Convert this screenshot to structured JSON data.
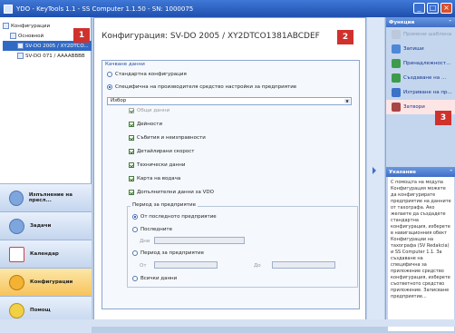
{
  "window": {
    "title": "YDO - KeyTools 1.1 - SS Computer 1.1.50 - SN: 1000075"
  },
  "tree": {
    "items": [
      {
        "label": "Конфигурации"
      },
      {
        "label": "Основной"
      },
      {
        "label": "SV-DO 2005 / XY2DTCO...",
        "selected": true
      },
      {
        "label": "SV-DO 071 / AAAABBBB"
      }
    ]
  },
  "nav": {
    "items": [
      {
        "label": "Изпълнение на пресл...",
        "icon": "clock-icon"
      },
      {
        "label": "Задачи",
        "icon": "tasks-icon"
      },
      {
        "label": "Календар",
        "icon": "calendar-icon"
      },
      {
        "label": "Конфигурации",
        "icon": "gear-icon",
        "active": true
      },
      {
        "label": "Помощ",
        "icon": "help-icon"
      }
    ]
  },
  "main": {
    "title": "Конфигурация: SV-DO 2005 / XY2DTCO1381ABCDEF",
    "group_label": "Качване данни",
    "radio_standard": "Стандартна конфигурация",
    "radio_specific": "Специфична на производителя средство настройки за предприятие",
    "select_value": "Избор",
    "checkboxes": [
      {
        "label": "Общи данни",
        "checked": true,
        "disabled": true
      },
      {
        "label": "Дейности",
        "checked": true
      },
      {
        "label": "Събития и неизправности",
        "checked": true
      },
      {
        "label": "Детайлирани скорост",
        "checked": true
      },
      {
        "label": "Технически данни",
        "checked": true
      },
      {
        "label": "Карта на водача",
        "checked": true
      },
      {
        "label": "Допълнителни данни за VDO",
        "checked": true
      }
    ],
    "period_label": "Период за предприятие",
    "period_options": [
      {
        "label": "От последното предприятие",
        "checked": true
      },
      {
        "label": "Последните",
        "checked": false
      },
      {
        "label": "Период за предприятие",
        "checked": false
      },
      {
        "label": "Всички данни",
        "checked": false
      }
    ],
    "days_label": "Дни",
    "from_label": "От",
    "to_label": "До"
  },
  "badges": [
    "1",
    "2",
    "3"
  ],
  "right": {
    "actions_title": "Функции",
    "actions": [
      {
        "label": "Промени шаблона",
        "disabled": true
      },
      {
        "label": "Запиши",
        "disabled": false
      },
      {
        "label": "Принадлежност...",
        "disabled": false
      },
      {
        "label": "Създаване на ...",
        "disabled": false
      },
      {
        "label": "Изтриване на пр...",
        "disabled": false
      },
      {
        "label": "Затвори",
        "disabled": false,
        "highlight": true
      }
    ],
    "info_title": "Указание",
    "info_text": "С помощта на модула Конфигурация можете да конфигурирате предприятие на данните от тахографа. Ако желаете да създадете стандартна конфигурация, изберете в навигационния обект Конфигурации на тахографа (SV Redakcia) и SS Computer 1.1. За създаване на специфична за приложение средство конфигурация, изберете съответното средство приложение. Записване предприятие..."
  }
}
